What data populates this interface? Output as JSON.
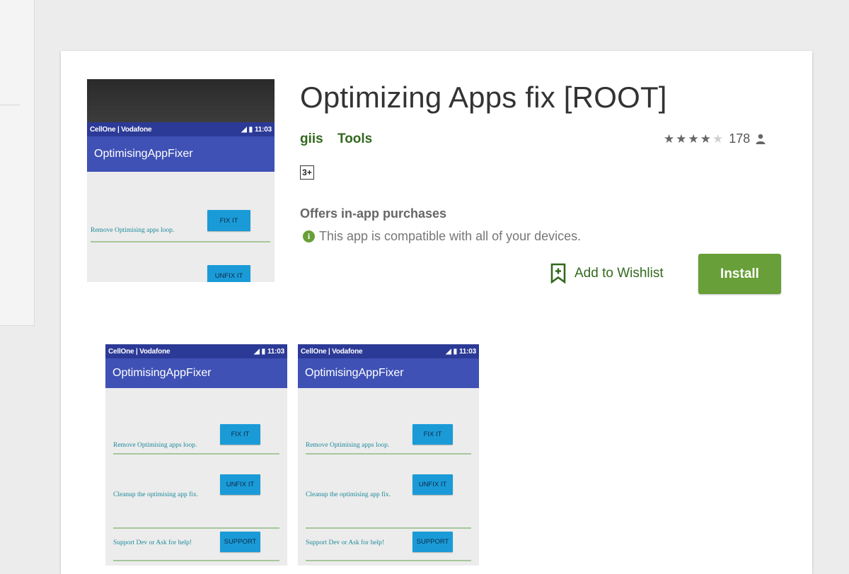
{
  "app": {
    "title": "Optimizing Apps fix [ROOT]",
    "developer": "giis",
    "category": "Tools",
    "rating_stars": 4,
    "rating_count": "178",
    "content_rating": "3+",
    "in_app_purchases": "Offers in-app purchases",
    "compatibility": "This app is compatible with all of your devices.",
    "wishlist_label": "Add to Wishlist",
    "install_label": "Install"
  },
  "colors": {
    "accent": "#689f38",
    "link": "#33691e",
    "phone_toolbar": "#3f51b5",
    "phone_statusbar": "#2c3a97",
    "phone_button": "#1a9bd7"
  },
  "icons": [
    "info-icon",
    "bookmark-plus-icon",
    "person-icon",
    "signal-icon",
    "battery-icon",
    "warning-icon",
    "message-icon",
    "star-icon"
  ],
  "phone": {
    "carrier": "CellOne | Vodafone",
    "time": "11:03",
    "app_name": "OptimisingAppFixer",
    "rows": [
      {
        "label": "Remove Optimising apps loop.",
        "button": "FIX IT"
      },
      {
        "label": "Cleanup the optimising app fix.",
        "button": "UNFIX IT"
      },
      {
        "label": "Support Dev or Ask for help!",
        "button": "SUPPORT"
      }
    ]
  }
}
